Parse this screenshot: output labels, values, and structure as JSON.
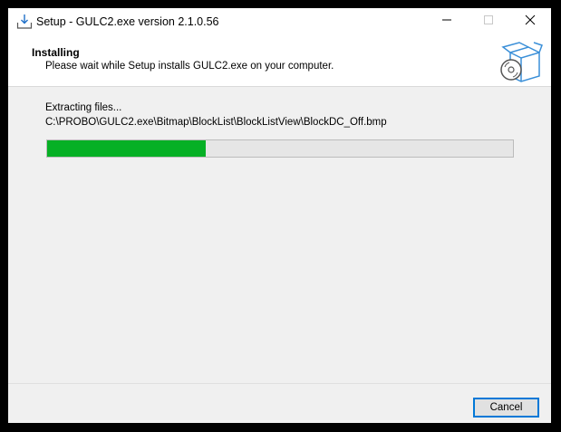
{
  "window": {
    "title": "Setup - GULC2.exe version 2.1.0.56",
    "icon": "setup-download-icon"
  },
  "titlebar_buttons": {
    "minimize_icon": "minimize-icon",
    "maximize_icon": "maximize-icon",
    "close_icon": "close-icon"
  },
  "header": {
    "title": "Installing",
    "subtitle": "Please wait while Setup installs GULC2.exe on your computer.",
    "icon": "install-box-disc-icon"
  },
  "main": {
    "status_text": "Extracting files...",
    "current_file": "C:\\PROBO\\GULC2.exe\\Bitmap\\BlockList\\BlockListView\\BlockDC_Off.bmp",
    "progress_fraction": 0.34,
    "progress_color": "#06b025"
  },
  "footer": {
    "cancel_label": "Cancel"
  }
}
